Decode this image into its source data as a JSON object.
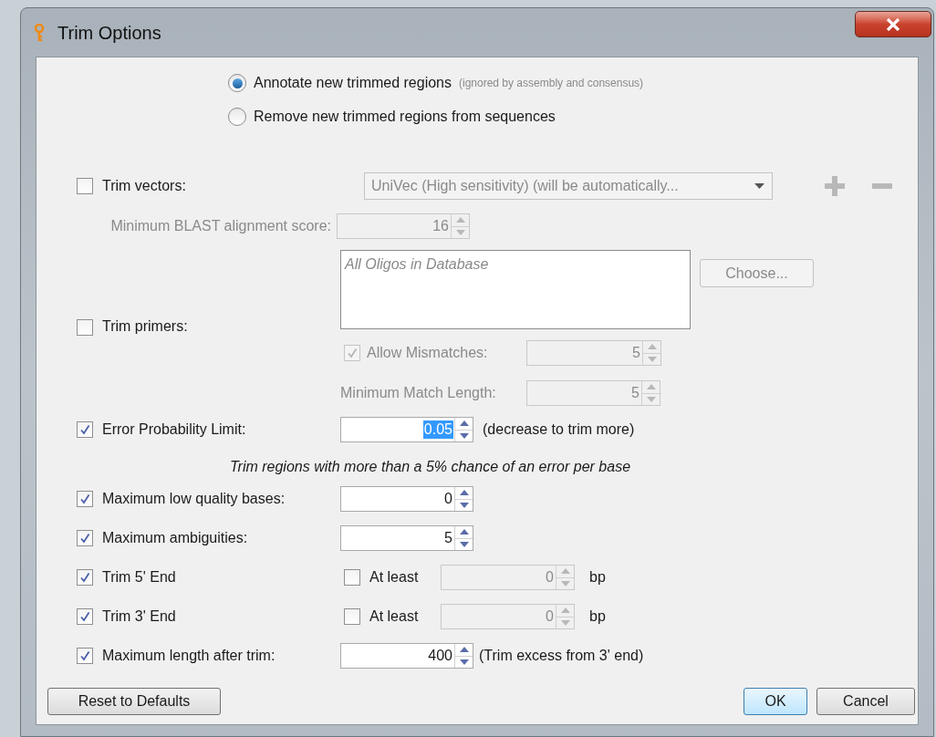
{
  "window": {
    "title": "Trim Options"
  },
  "trim_mode": [
    {
      "label": "Annotate new trimmed regions",
      "note": "(ignored by assembly and consensus)",
      "selected": true
    },
    {
      "label": "Remove new trimmed regions from sequences",
      "selected": false
    }
  ],
  "trim_vectors": {
    "label": "Trim vectors:",
    "checked": false,
    "database": "UniVec (High sensitivity) (will be automatically...",
    "min_score": {
      "label": "Minimum BLAST alignment score:",
      "value": "16"
    }
  },
  "trim_primers": {
    "label": "Trim primers:",
    "checked": false,
    "oligos": "All Oligos in Database",
    "choose_button": "Choose...",
    "allow_mismatches": {
      "label": "Allow Mismatches:",
      "checked": true,
      "value": "5"
    },
    "min_match_length": {
      "label": "Minimum Match Length:",
      "value": "5"
    }
  },
  "error_probability": {
    "label": "Error Probability Limit:",
    "checked": true,
    "value": "0.05",
    "value_selected": true,
    "note": "(decrease to trim more)",
    "hint": "Trim regions with more than a 5% chance of an error per base"
  },
  "options": [
    {
      "kind": "spinner",
      "label": "Maximum low quality bases:",
      "checked": true,
      "value": "0"
    },
    {
      "kind": "spinner",
      "label": "Maximum ambiguities:",
      "checked": true,
      "value": "5"
    },
    {
      "kind": "end",
      "label": "Trim 5' End",
      "checked": true,
      "at_least": {
        "label": "At least",
        "checked": false,
        "value": "0",
        "unit": "bp"
      }
    },
    {
      "kind": "end",
      "label": "Trim 3' End",
      "checked": true,
      "at_least": {
        "label": "At least",
        "checked": false,
        "value": "0",
        "unit": "bp"
      }
    },
    {
      "kind": "spinner",
      "label": "Maximum length after trim:",
      "checked": true,
      "value": "400",
      "note": "(Trim excess from 3' end)"
    }
  ],
  "buttons": [
    {
      "label": "Reset to Defaults",
      "default": false
    },
    {
      "label": "OK",
      "default": true
    },
    {
      "label": "Cancel",
      "default": false
    }
  ]
}
